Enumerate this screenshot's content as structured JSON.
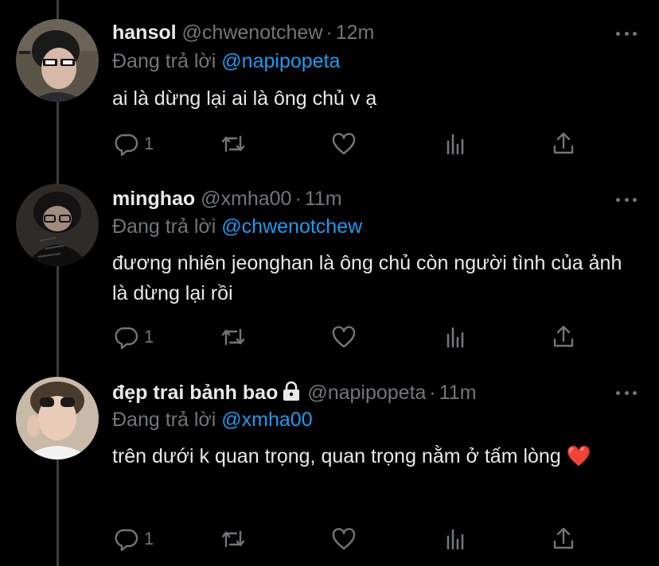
{
  "tweets": [
    {
      "name": "hansol",
      "handle": "@chwenotchew",
      "time": "12m",
      "reply_prefix": "Đang trả lời",
      "reply_to": "@napipopeta",
      "text": "ai là dừng lại ai là ông chủ v ạ",
      "reply_count": "1"
    },
    {
      "name": "minghao",
      "handle": "@xmha00",
      "time": "11m",
      "reply_prefix": "Đang trả lời",
      "reply_to": "@chwenotchew",
      "text": "đương nhiên jeonghan là ông chủ còn người tình của ảnh là dừng lại rồi",
      "reply_count": "1"
    },
    {
      "name": "đẹp trai bảnh bao",
      "handle": "@napipopeta",
      "time": "11m",
      "reply_prefix": "Đang trả lời",
      "reply_to": "@xmha00",
      "text": "trên dưới k quan trọng, quan trọng nằm ở tấm lòng ❤️",
      "reply_count": "1",
      "protected": true
    }
  ],
  "icons": {
    "reply": "reply-icon",
    "retweet": "retweet-icon",
    "like": "heart-icon",
    "analytics": "analytics-icon",
    "share": "share-icon",
    "more": "more-icon",
    "lock": "lock-icon"
  },
  "colors": {
    "background": "#000000",
    "text": "#e7e9ea",
    "muted": "#71767b",
    "mention": "#1d9bf0",
    "thread_line": "#3a3d40"
  }
}
